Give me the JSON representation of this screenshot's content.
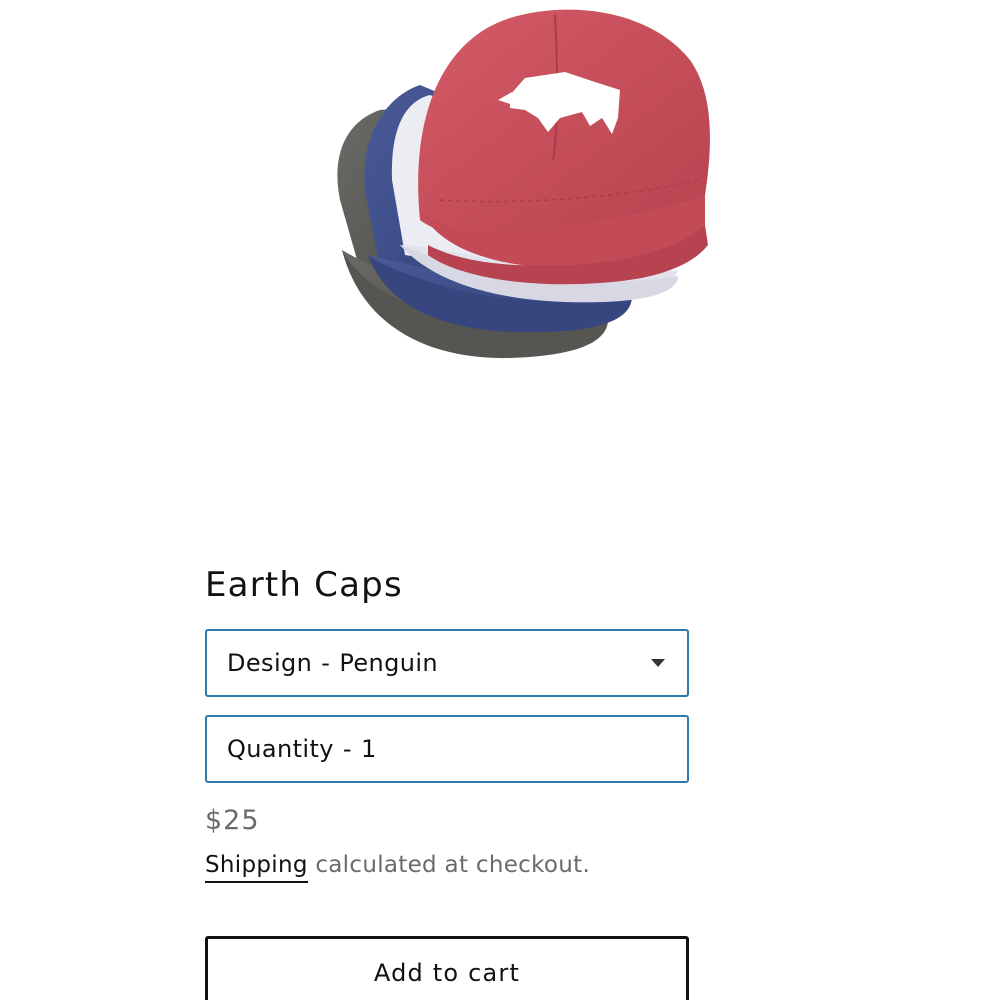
{
  "product": {
    "title": "Earth Caps",
    "image_alt": "Stack of washed baseball caps in grey, navy, white and red with a rhino logo",
    "colors": {
      "cap_grey": "#5b5b58",
      "cap_navy": "#3e4f8c",
      "cap_white": "#ececf4",
      "cap_red": "#c9505c",
      "field_border": "#2f78a8"
    }
  },
  "variant_select": {
    "label": "Design",
    "separator": "-",
    "value": "Penguin"
  },
  "quantity": {
    "label": "Quantity",
    "separator": "-",
    "value": "1"
  },
  "price": "$25",
  "shipping": {
    "link_text": "Shipping",
    "rest_text": " calculated at checkout."
  },
  "cart": {
    "button_label": "Add to cart"
  }
}
